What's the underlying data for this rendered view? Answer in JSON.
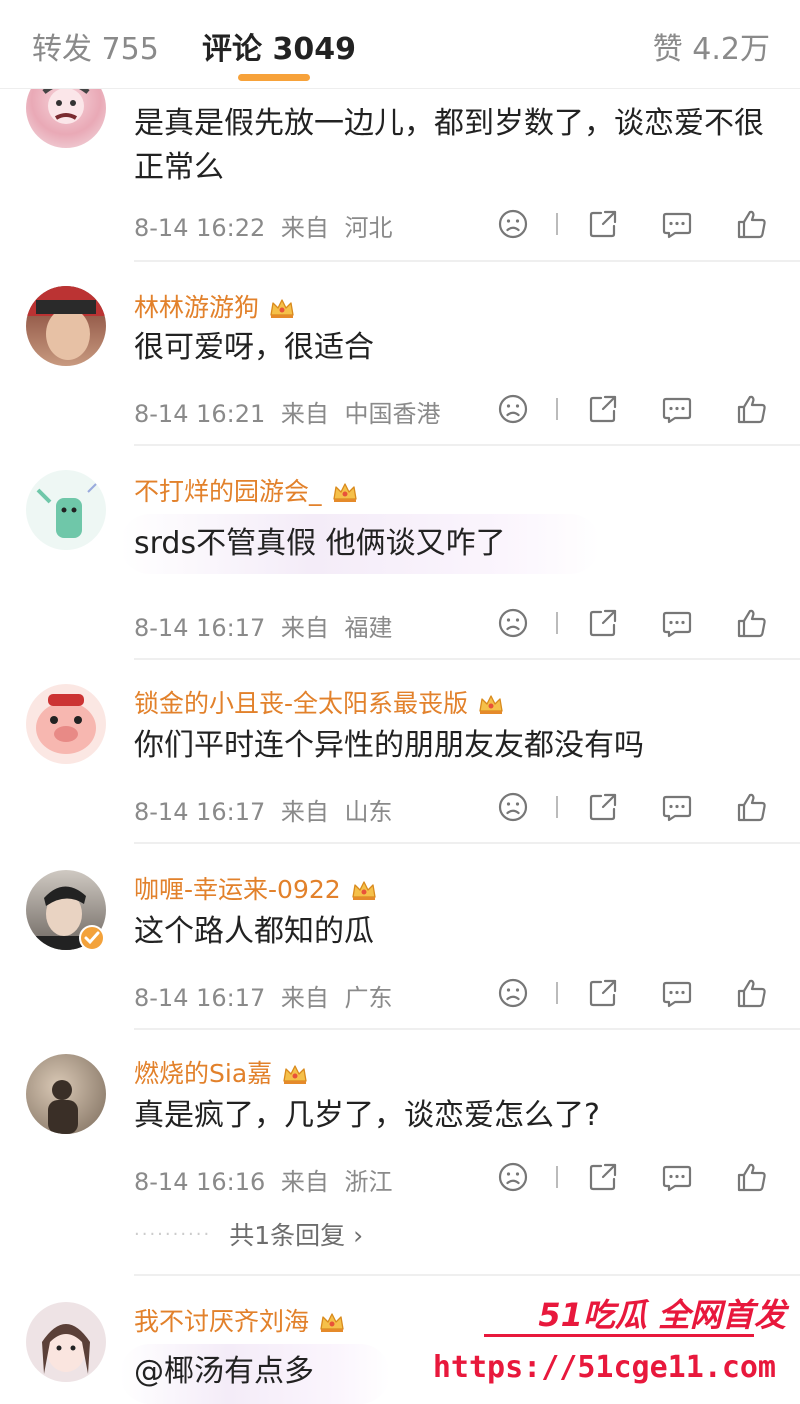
{
  "tabs": {
    "reposts": "转发 755",
    "comments": "评论 3049",
    "likes": "赞 4.2万"
  },
  "comments": [
    {
      "username": "",
      "text": "是真是假先放一边儿，都到岁数了，谈恋爱不很正常么",
      "time": "8-14 16:22",
      "from": "来自",
      "location": "河北"
    },
    {
      "username": "林林游游狗",
      "text": "很可爱呀，很适合",
      "time": "8-14 16:21",
      "from": "来自",
      "location": "中国香港"
    },
    {
      "username": "不打烊的园游会_",
      "text": "srds不管真假 他俩谈又咋了",
      "time": "8-14 16:17",
      "from": "来自",
      "location": "福建"
    },
    {
      "username": "锁金的小且丧-全太阳系最丧版",
      "text": "你们平时连个异性的朋朋友友都没有吗",
      "time": "8-14 16:17",
      "from": "来自",
      "location": "山东"
    },
    {
      "username": "咖喱-幸运来-0922",
      "text": "这个路人都知的瓜",
      "time": "8-14 16:17",
      "from": "来自",
      "location": "广东"
    },
    {
      "username": "燃烧的Sia嘉",
      "text": "真是疯了，几岁了，谈恋爱怎么了?",
      "time": "8-14 16:16",
      "from": "来自",
      "location": "浙江",
      "replies": "共1条回复 ›"
    },
    {
      "username": "我不讨厌齐刘海",
      "text": "@椰汤有点多"
    }
  ],
  "watermark": {
    "title": "51吃瓜 全网首发",
    "url": "https://51cge11.com"
  },
  "colors": {
    "username": "#e2812b",
    "tab_underline": "#f7a23a",
    "watermark": "#e8183c"
  }
}
